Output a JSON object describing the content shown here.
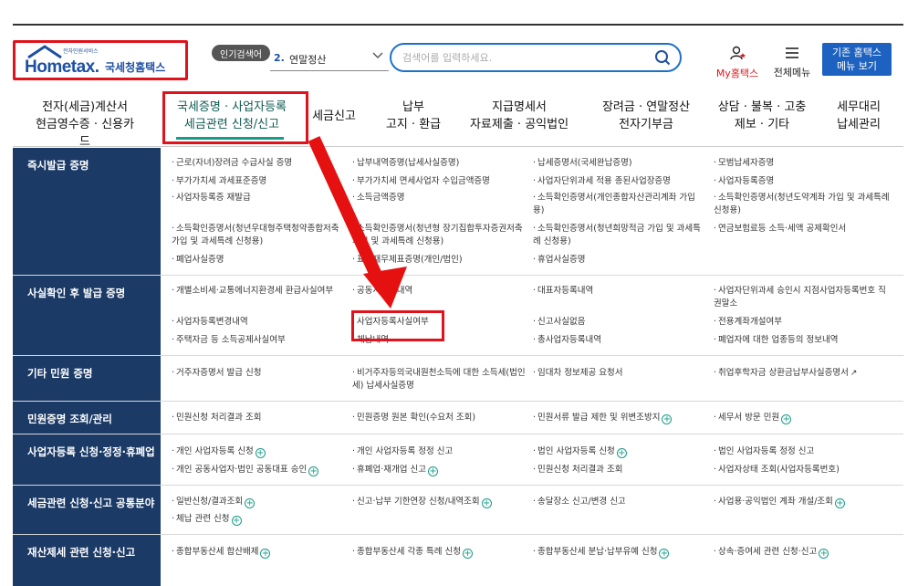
{
  "header": {
    "logo_small": "전자민원서비스",
    "logo_main": "Hometax.",
    "logo_kor": "국세청홈택스",
    "popular_badge": "인기검색어",
    "popular_rank": "2.",
    "popular_term": "연말정산",
    "search_placeholder": "검색어를 입력하세요.",
    "my_hometax": "My홈택스",
    "all_menu": "전체메뉴",
    "legacy_line1": "기존 홈택스",
    "legacy_line2": "메뉴 보기"
  },
  "nav": [
    {
      "l1": "전자(세금)계산서",
      "l2": "현금영수증 · 신용카드"
    },
    {
      "l1": "국세증명 · 사업자등록",
      "l2": "세금관련 신청/신고"
    },
    {
      "l1": "세금신고",
      "l2": ""
    },
    {
      "l1": "납부",
      "l2": "고지 · 환급"
    },
    {
      "l1": "지급명세서",
      "l2": "자료제출 · 공익법인"
    },
    {
      "l1": "장려금 · 연말정산",
      "l2": "전자기부금"
    },
    {
      "l1": "상담 · 불복 · 고충",
      "l2": "제보 · 기타"
    },
    {
      "l1": "세무대리",
      "l2": "납세관리"
    }
  ],
  "rows": [
    {
      "head": "즉시발급 증명",
      "cells": [
        "근로(자녀)장려금 수급사실 증명",
        "납부내역증명(납세사실증명)",
        "납세증명서(국세완납증명)",
        "모범납세자증명",
        "부가가치세 과세표준증명",
        "부가가치세 면세사업자 수입금액증명",
        "사업자단위과세 적용 종된사업장증명",
        "사업자등록증명",
        "사업자등록증 재발급",
        "소득금액증명",
        "소득확인증명서(개인종합자산관리계좌 가입용)",
        "소득확인증명서(청년도약계좌 가입 및 과세특례 신청용)",
        "소득확인증명서(청년우대형주택청약종합저축 가입 및 과세특례 신청용)",
        "소득확인증명서(청년형 장기집합투자증권저축 가입 및 과세특례 신청용)",
        "소득확인증명서(청년희망적금 가입 및 과세특례 신청용)",
        "연금보험료등 소득·세액 공제확인서",
        "폐업사실증명",
        "표준재무제표증명(개인/법인)",
        "휴업사실증명"
      ]
    },
    {
      "head": "사실확인 후 발급 증명",
      "cells": [
        "개별소비세·교통에너지환경세 환급사실여부",
        "공동사업자내역",
        "대표자등록내역",
        "사업자단위과세 승인시 지점사업자등록번호 직권말소",
        "사업자등록변경내역",
        "사업자등록사실여부",
        "신고사실없음",
        "전용계좌개설여부",
        "주택자금 등 소득공제사실여부",
        "체납내역",
        "총사업자등록내역",
        "폐업자에 대한 업종등의 정보내역"
      ]
    },
    {
      "head": "기타 민원 증명",
      "cells": [
        "거주자증명서 발급 신청",
        "비거주자등의국내원천소득에 대한 소득세(법인세) 납세사실증명",
        "임대차 정보제공 요청서",
        "취업후학자금 상환금납부사실증명서"
      ]
    },
    {
      "head": "민원증명 조회/관리",
      "cells": [
        "민원신청 처리결과 조회",
        "민원증명 원본 확인(수요처 조회)",
        "민원서류 발급 제한 및 위변조방지",
        "세무서 방문 민원"
      ]
    },
    {
      "head": "사업자등록 신청·정정·휴폐업",
      "cells": [
        "개인 사업자등록 신청",
        "개인 사업자등록 정정 신고",
        "법인 사업자등록 신청",
        "법인 사업자등록 정정 신고",
        "개인 공동사업자·법인 공동대표 승인",
        "휴폐업·재개업 신고",
        "민원신청 처리결과 조회",
        "사업자상태 조회(사업자등록번호)"
      ]
    },
    {
      "head": "세금관련 신청·신고 공통분야",
      "cells": [
        "일반신청/결과조회",
        "신고·납부 기한연장 신청/내역조회",
        "송달장소 신고/변경 신고",
        "사업용·공익법인 계좌 개설/조회",
        "체납 관련 신청"
      ]
    },
    {
      "head": "재산제세 관련 신청·신고",
      "cells": [
        "종합부동산세 합산배제",
        "종합부동산세 각종 특례 신청",
        "종합부동산세 분납·납부유예 신청",
        "상속·증여세 관련 신청·신고"
      ]
    }
  ]
}
